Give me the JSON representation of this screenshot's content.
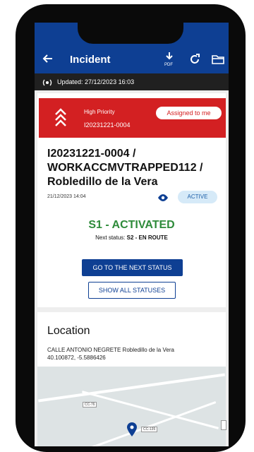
{
  "appbar": {
    "title": "Incident",
    "back_icon": "arrow-left-icon",
    "pdf_icon": "pdf-download-icon",
    "refresh_icon": "refresh-icon",
    "folder_icon": "folder-open-icon",
    "color": "#0e3f93"
  },
  "updated": {
    "text": "Updated: 27/12/2023 16:03",
    "icon": "signal-broadcast-icon"
  },
  "priority": {
    "label": "High Priority",
    "code": "I20231221-0004",
    "assigned_label": "Assigned to me",
    "icon": "double-chevron-up-icon",
    "color": "#d32022"
  },
  "incident": {
    "title": "I20231221-0004 / WORKACCMVTRAPPED112 / Robledillo de la Vera",
    "date": "21/12/2023 14:04",
    "view_icon": "eye-icon",
    "badge": "ACTIVE"
  },
  "status": {
    "current": "S1  - ACTIVATED",
    "next_prefix": "Next status: ",
    "next_value": "S2 - EN ROUTE",
    "next_button": "GO TO THE NEXT STATUS",
    "all_button": "SHOW ALL STATUSES",
    "current_color": "#2e8b3a"
  },
  "location": {
    "heading": "Location",
    "address": "CALLE ANTONIO NEGRETE Robledillo de la Vera",
    "coords": "40.100872, -5.5886426",
    "map": {
      "road_labels": [
        "CC-76",
        "CC-135"
      ],
      "pin_icon": "map-pin-icon"
    }
  }
}
